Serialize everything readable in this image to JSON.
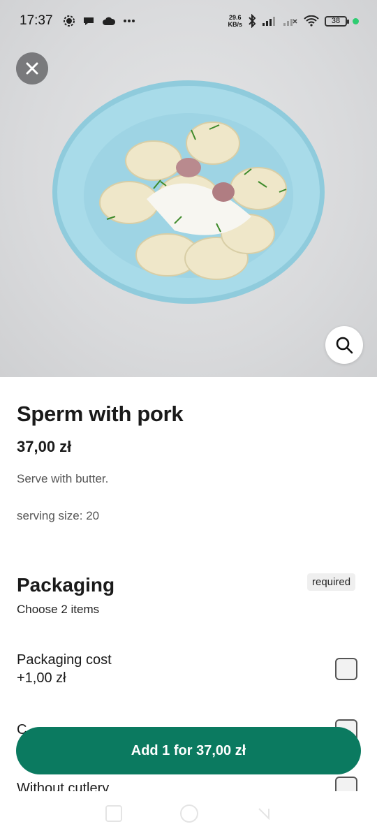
{
  "status_bar": {
    "time": "17:37",
    "speed_value": "29.6",
    "speed_unit": "KB/s",
    "battery": "38",
    "icons": [
      "signal-app-icon",
      "chat-icon",
      "cloud-icon",
      "more-dots-icon",
      "bluetooth-icon",
      "cellular-signal-icon",
      "cellular-signal-2-icon",
      "wifi-icon",
      "battery-icon"
    ]
  },
  "hero": {
    "close_icon": "close-icon",
    "zoom_icon": "search-icon"
  },
  "product": {
    "title": "Sperm with pork",
    "price": "37,00 zł",
    "description": "Serve with butter.",
    "serving": "serving size: 20"
  },
  "packaging": {
    "title": "Packaging",
    "badge": "required",
    "subtitle": "Choose 2 items",
    "options": [
      {
        "label": "Packaging cost",
        "price": "+1,00 zł",
        "checked": false
      },
      {
        "label": "C",
        "checked": false
      },
      {
        "label": "Without cutlery",
        "checked": false
      }
    ]
  },
  "cta": {
    "label": "Add 1 for 37,00 zł",
    "color": "#0b7a60"
  }
}
